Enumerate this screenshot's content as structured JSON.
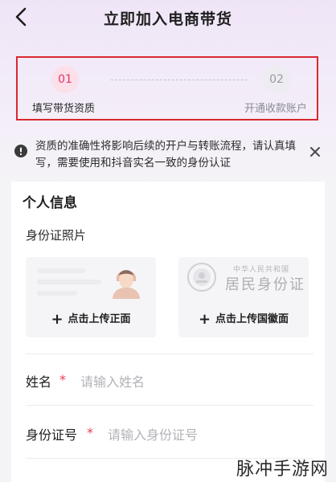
{
  "header": {
    "title": "立即加入电商带货"
  },
  "steps": [
    {
      "number": "01",
      "label": "填写带货资质"
    },
    {
      "number": "02",
      "label": "开通收款账户"
    }
  ],
  "notice": {
    "text": "资质的准确性将影响后续的开户与转账流程，请认真填写，需要使用和抖音实名一致的身份认证"
  },
  "personal_info": {
    "section_title": "个人信息",
    "id_photo_label": "身份证照片",
    "upload_front": "点击上传正面",
    "upload_back": "点击上传国徽面",
    "id_card_country": "中华人民共和国",
    "id_card_title": "居民身份证",
    "name_label": "姓名",
    "name_placeholder": "请输入姓名",
    "id_number_label": "身份证号",
    "id_number_placeholder": "请输入身份证号",
    "required_mark": "*"
  },
  "watermark": "脉冲手游网",
  "colors": {
    "accent": "#e0386b",
    "highlight_border": "#d9282e",
    "required": "#e83c52"
  }
}
